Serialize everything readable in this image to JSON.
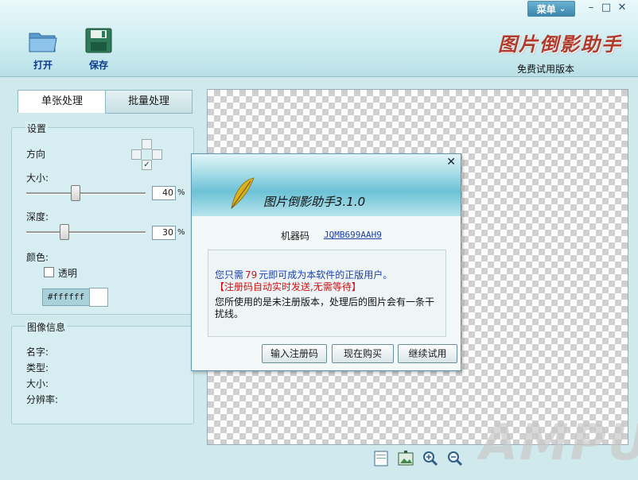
{
  "header": {
    "open_label": "打开",
    "save_label": "保存",
    "menu_label": "菜单",
    "logo_text": "图片倒影助手",
    "edition": "免费试用版本",
    "window_min": "–",
    "window_max": "□",
    "window_close": "✕"
  },
  "tabs": {
    "single": "单张处理",
    "batch": "批量处理"
  },
  "settings": {
    "title": "设置",
    "direction_label": "方向",
    "size_label": "大小:",
    "size_value": "40",
    "size_unit": "%",
    "depth_label": "深度:",
    "depth_value": "30",
    "depth_unit": "%",
    "color_label": "颜色:",
    "transparent_label": "透明",
    "transparent_checked": false,
    "color_code": "#ffffff",
    "direction_check": "✓"
  },
  "image_info": {
    "title": "图像信息",
    "name_label": "名字:",
    "type_label": "类型:",
    "size_label": "大小:",
    "resolution_label": "分辨率:"
  },
  "dialog": {
    "title": "图片倒影助手3.1.0",
    "close": "✕",
    "machine_code_label": "机器码",
    "machine_code": "JQMB699AAH9",
    "msg_prefix": "您只需",
    "msg_price": "79",
    "msg_suffix": "元即可成为本软件的正版用户。",
    "msg_red": "【注册码自动实时发送,无需等待】",
    "msg_unregistered": "您所使用的是未注册版本，处理后的图片会有一条干扰线。",
    "btn_register": "输入注册码",
    "btn_buy": "现在购买",
    "btn_continue": "继续试用"
  },
  "watermark": "AMPUN",
  "colors": {
    "accent_blue": "#0a3b8c",
    "price_red": "#d01010",
    "panel_bg": "#d6eef1"
  }
}
